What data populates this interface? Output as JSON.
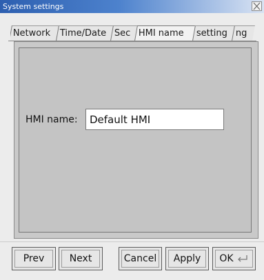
{
  "window": {
    "title": "System settings"
  },
  "tabs": [
    {
      "label": "Network",
      "active": false
    },
    {
      "label": "Time/Date",
      "active": false
    },
    {
      "label": "Sec",
      "active": false
    },
    {
      "label": "HMI name",
      "active": true
    },
    {
      "label": "setting",
      "active": false
    },
    {
      "label": "ng",
      "active": false
    }
  ],
  "form": {
    "hmi_name_label": "HMI name:",
    "hmi_name_value": "Default HMI"
  },
  "buttons": {
    "prev": "Prev",
    "next": "Next",
    "cancel": "Cancel",
    "apply": "Apply",
    "ok": "OK",
    "ok_icon": "enter-key-icon"
  }
}
